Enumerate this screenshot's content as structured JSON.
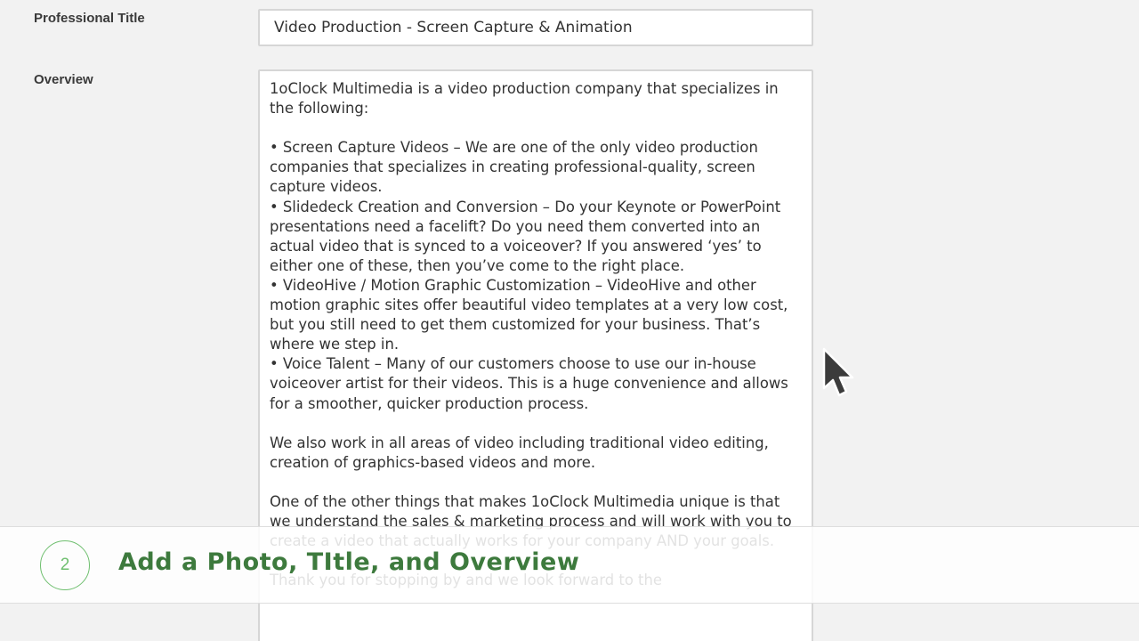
{
  "form": {
    "title_label": "Professional Title",
    "title_value": "Video Production - Screen Capture & Animation",
    "overview_label": "Overview",
    "overview_text": "1oClock Multimedia is a video production company that specializes in the following:\n\n• Screen Capture Videos – We are one of the only video production companies that specializes in creating professional-quality, screen capture videos.\n• Slidedeck Creation and Conversion – Do your Keynote or PowerPoint presentations need a facelift? Do you need them converted into an actual video that is synced to a voiceover? If you answered ‘yes’ to either one of these, then you’ve come to the right place.\n• VideoHive / Motion Graphic Customization – VideoHive and other motion graphic sites offer beautiful video templates at a very low cost, but you still need to get them customized for your business. That’s where we step in.\n• Voice Talent – Many of our customers choose to use our in-house voiceover artist for their videos. This is a huge convenience and allows for a smoother, quicker production process.\n\nWe also work in all areas of video including traditional video editing, creation of graphics-based videos and more.\n\nOne of the other things that makes 1oClock Multimedia unique is that we understand the sales & marketing process and will work with you to create a video that actually works for your company AND your goals.\n\nThank you for stopping by and we look forward to the"
  },
  "banner": {
    "step_number": "2",
    "title": "Add a Photo, TItle, and Overview",
    "accent_color": "#3d7a3d",
    "circle_color": "#6fbf6f"
  },
  "cursor": {
    "icon": "mouse-pointer-icon"
  }
}
